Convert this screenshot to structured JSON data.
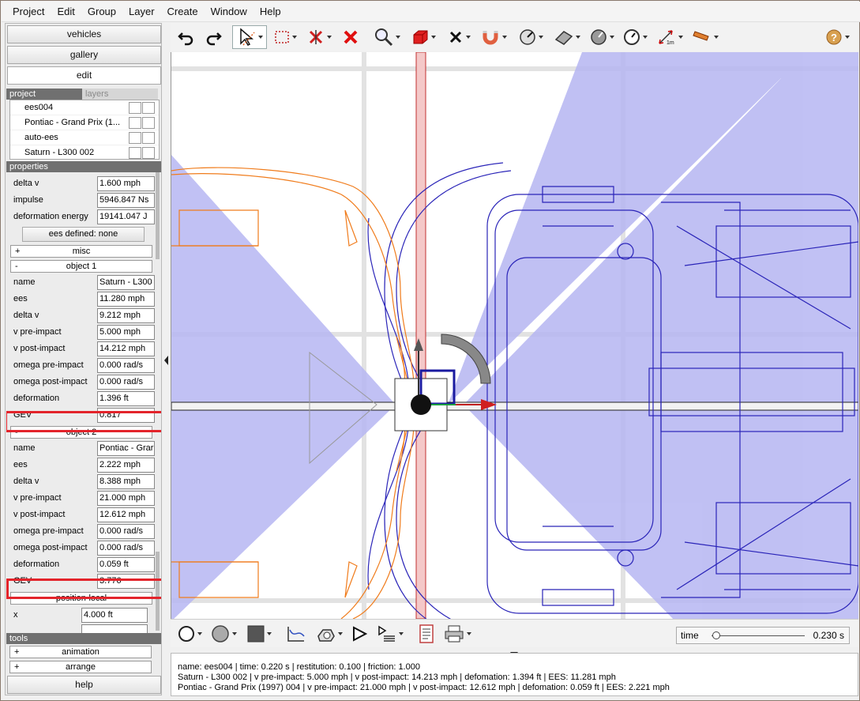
{
  "menu": [
    "Project",
    "Edit",
    "Group",
    "Layer",
    "Create",
    "Window",
    "Help"
  ],
  "nav": {
    "vehicles": "vehicles",
    "gallery": "gallery",
    "edit": "edit",
    "help": "help"
  },
  "tabs": {
    "project": "project",
    "layers": "layers"
  },
  "project_items": [
    "ees004",
    "Pontiac - Grand Prix (1...",
    "auto-ees",
    "Saturn - L300 002"
  ],
  "properties": {
    "header": "properties",
    "top_rows": [
      {
        "label": "delta v",
        "value": "1.600 mph"
      },
      {
        "label": "impulse",
        "value": "5946.847 Ns"
      },
      {
        "label": "deformation energy",
        "value": "19141.047 J"
      }
    ],
    "ees_button": "ees defined: none",
    "misc": {
      "sign": "+",
      "label": "misc"
    },
    "object1": {
      "sign": "-",
      "label": "object 1",
      "rows": [
        {
          "label": "name",
          "value": "Saturn - L300"
        },
        {
          "label": "ees",
          "value": "11.280 mph"
        },
        {
          "label": "delta v",
          "value": "9.212 mph"
        },
        {
          "label": "v pre-impact",
          "value": "5.000 mph"
        },
        {
          "label": "v post-impact",
          "value": "14.212 mph"
        },
        {
          "label": "omega pre-impact",
          "value": "0.000 rad/s"
        },
        {
          "label": "omega post-impact",
          "value": "0.000 rad/s"
        },
        {
          "label": "deformation",
          "value": "1.396 ft"
        },
        {
          "label": "GEV",
          "value": "0.817"
        }
      ]
    },
    "object2": {
      "sign": "-",
      "label": "object 2",
      "rows": [
        {
          "label": "name",
          "value": "Pontiac - Grar"
        },
        {
          "label": "ees",
          "value": "2.222 mph"
        },
        {
          "label": "delta v",
          "value": "8.388 mph"
        },
        {
          "label": "v pre-impact",
          "value": "21.000 mph"
        },
        {
          "label": "v post-impact",
          "value": "12.612 mph"
        },
        {
          "label": "omega pre-impact",
          "value": "0.000 rad/s"
        },
        {
          "label": "omega post-impact",
          "value": "0.000 rad/s"
        },
        {
          "label": "deformation",
          "value": "0.059 ft"
        },
        {
          "label": "GEV",
          "value": "3.776"
        }
      ]
    },
    "position_local": {
      "sign": "-",
      "label": "position-local"
    },
    "x": {
      "label": "x",
      "value": "4.000 ft"
    }
  },
  "tools": {
    "header": "tools",
    "animation": {
      "sign": "+",
      "label": "animation"
    },
    "arrange": {
      "sign": "+",
      "label": "arrange"
    }
  },
  "toolbar_icons": [
    "undo-icon",
    "redo-icon",
    "select-arrow-icon",
    "selection-rect-icon",
    "delete-node-icon",
    "delete-icon",
    "zoom-icon",
    "box-3d-icon",
    "x-axis-icon",
    "magnet-icon",
    "angle-gauge-icon",
    "ramp-icon",
    "compass-icon",
    "speedometer-icon",
    "measure-1m-icon",
    "cylinder-icon",
    "help-icon"
  ],
  "time": {
    "label": "time",
    "value": "0.230 s",
    "fraction": 0.05
  },
  "status_lines": [
    "name: ees004 | time: 0.220 s | restitution: 0.100 | friction: 1.000",
    "Saturn - L300 002 | v pre-impact: 5.000 mph | v post-impact: 14.213 mph | defomation: 1.394 ft | EES: 11.281 mph",
    "Pontiac - Grand Prix (1997) 004 | v pre-impact: 21.000 mph | v post-impact: 12.612 mph | defomation: 0.059 ft | EES: 2.221 mph"
  ],
  "colors": {
    "accent_red": "#e3242b",
    "fov_blue": "#b6b6f2",
    "vehicle_blue": "#2a24b8",
    "vehicle_orange": "#f07c1c"
  }
}
